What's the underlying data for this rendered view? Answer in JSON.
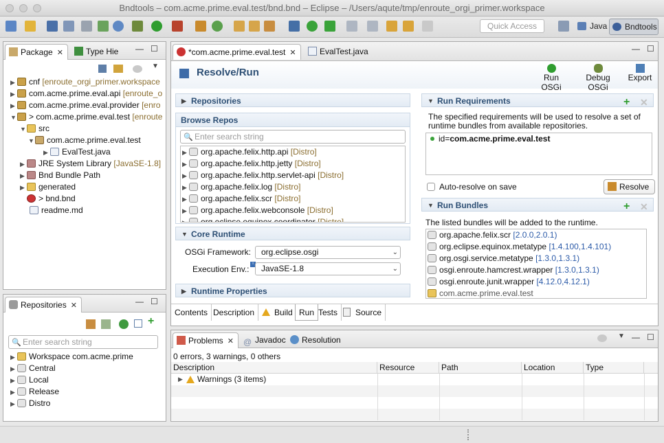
{
  "window": {
    "title": "Bndtools – com.acme.prime.eval.test/bnd.bnd – Eclipse – /Users/aqute/tmp/enroute_orgi_primer.workspace"
  },
  "toolbar": {
    "quick_access": "Quick Access",
    "perspectives": [
      "Java",
      "Bndtools"
    ]
  },
  "package_explorer": {
    "tabs": [
      {
        "label": "Package"
      },
      {
        "label": "Type Hie"
      }
    ],
    "tree": [
      {
        "label": "cnf",
        "decoration": "[enroute_orgi_primer.workspace"
      },
      {
        "label": "com.acme.prime.eval.api",
        "decoration": "[enroute_o"
      },
      {
        "label": "com.acme.prime.eval.provider",
        "decoration": "[enro"
      },
      {
        "label": "> com.acme.prime.eval.test",
        "decoration": "[enroute"
      },
      {
        "label": "src",
        "decoration": ""
      },
      {
        "label": "com.acme.prime.eval.test",
        "decoration": ""
      },
      {
        "label": "EvalTest.java",
        "decoration": ""
      },
      {
        "label": "JRE System Library",
        "decoration": "[JavaSE-1.8]"
      },
      {
        "label": "Bnd Bundle Path",
        "decoration": ""
      },
      {
        "label": "generated",
        "decoration": ""
      },
      {
        "label": "> bnd.bnd",
        "decoration": ""
      },
      {
        "label": "readme.md",
        "decoration": ""
      }
    ]
  },
  "repositories_view": {
    "title": "Repositories",
    "search_placeholder": "Enter search string",
    "items": [
      {
        "label": "Workspace com.acme.prime"
      },
      {
        "label": "Central"
      },
      {
        "label": "Local"
      },
      {
        "label": "Release"
      },
      {
        "label": "Distro"
      }
    ]
  },
  "editor": {
    "tabs": [
      {
        "label": "*com.acme.prime.eval.test"
      },
      {
        "label": "EvalTest.java"
      }
    ],
    "heading": "Resolve/Run",
    "actions": [
      {
        "label": "Run OSGi"
      },
      {
        "label": "Debug OSGi"
      },
      {
        "label": "Export"
      }
    ],
    "repositories_section": "Repositories",
    "browse_repos": {
      "title": "Browse Repos",
      "search_placeholder": "Enter search string",
      "bundles": [
        {
          "name": "org.apache.felix.http.api",
          "repo": "[Distro]"
        },
        {
          "name": "org.apache.felix.http.jetty",
          "repo": "[Distro]"
        },
        {
          "name": "org.apache.felix.http.servlet-api",
          "repo": "[Distro]"
        },
        {
          "name": "org.apache.felix.log",
          "repo": "[Distro]"
        },
        {
          "name": "org.apache.felix.scr",
          "repo": "[Distro]"
        },
        {
          "name": "org.apache.felix.webconsole",
          "repo": "[Distro]"
        },
        {
          "name": "org.eclipse.equinox.coordinator",
          "repo": "[Distro]"
        }
      ]
    },
    "core_runtime": {
      "title": "Core Runtime",
      "framework_label": "OSGi Framework:",
      "framework_value": "org.eclipse.osgi",
      "exec_env_label": "Execution Env.:",
      "exec_env_value": "JavaSE-1.8"
    },
    "runtime_properties": "Runtime Properties",
    "run_requirements": {
      "title": "Run Requirements",
      "description": "The specified requirements will be used to resolve a set of runtime bundles from available repositories.",
      "items": [
        {
          "key": "id=",
          "value": "com.acme.prime.eval.test"
        }
      ],
      "auto_resolve_label": "Auto-resolve on save",
      "auto_resolve_checked": false,
      "resolve_button": "Resolve"
    },
    "run_bundles": {
      "title": "Run Bundles",
      "description": "The listed bundles will be added to the runtime.",
      "items": [
        {
          "name": "org.apache.felix.scr",
          "range": "[2.0.0,2.0.1)"
        },
        {
          "name": "org.eclipse.equinox.metatype",
          "range": "[1.4.100,1.4.101)"
        },
        {
          "name": "org.osgi.service.metatype",
          "range": "[1.3.0,1.3.1)"
        },
        {
          "name": "osgi.enroute.hamcrest.wrapper",
          "range": "[1.3.0,1.3.1)"
        },
        {
          "name": "osgi.enroute.junit.wrapper",
          "range": "[4.12.0,4.12.1)"
        },
        {
          "name": "com.acme.prime.eval.test",
          "range": ""
        }
      ]
    },
    "page_tabs": [
      "Contents",
      "Description",
      "Build",
      "Run",
      "Tests",
      "Source"
    ],
    "active_page_tab": "Run"
  },
  "problems_view": {
    "tabs": [
      {
        "label": "Problems"
      },
      {
        "label": "Javadoc"
      },
      {
        "label": "Resolution"
      }
    ],
    "summary": "0 errors, 3 warnings, 0 others",
    "columns": [
      "Description",
      "Resource",
      "Path",
      "Location",
      "Type"
    ],
    "rows": [
      {
        "description": "Warnings (3 items)"
      }
    ]
  },
  "colors": {
    "section_title": "#2d4f74",
    "version_text": "#2b5aa8",
    "decoration": "#8a6d2f",
    "run_green": "#2f9d2f"
  }
}
